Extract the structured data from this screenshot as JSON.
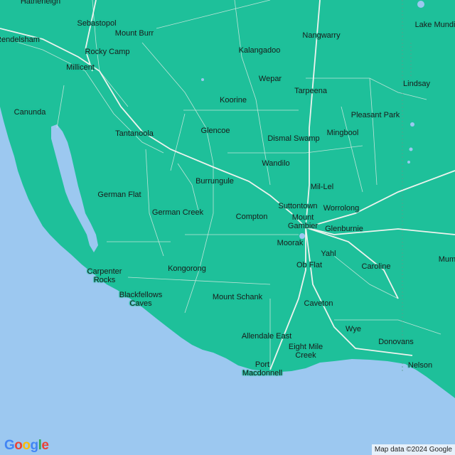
{
  "colors": {
    "land": "#1ec09a",
    "water": "#9cc8f0",
    "road": "#e8efe9",
    "highway": "#f2f2ec",
    "boundary": "#5c9c8a"
  },
  "labels": {
    "hatherleigh": "Hatherleigh",
    "sebastopol": "Sebastopol",
    "mount_burr": "Mount Burr",
    "rendelsham": "Rendelsham",
    "rocky_camp": "Rocky Camp",
    "millicent": "Millicent",
    "nangwarry": "Nangwarry",
    "kalangadoo": "Kalangadoo",
    "lake_mundi": "Lake Mundi",
    "wepar": "Wepar",
    "tarpeena": "Tarpeena",
    "lindsay": "Lindsay",
    "koorine": "Koorine",
    "canunda": "Canunda",
    "pleasant_park": "Pleasant Park",
    "tantanoola": "Tantanoola",
    "glencoe": "Glencoe",
    "mingbool": "Mingbool",
    "dismal_swamp": "Dismal Swamp",
    "wandilo": "Wandilo",
    "burrungule": "Burrungule",
    "mil_lel": "Mil-Lel",
    "german_flat": "German Flat",
    "suttontown": "Suttontown",
    "worrolong": "Worrolong",
    "german_creek": "German Creek",
    "compton": "Compton",
    "mount_gambier": "Mount\nGambier",
    "glenburnie": "Glenburnie",
    "moorak": "Moorak",
    "yahl": "Yahl",
    "mum": "Mum",
    "ob_flat": "Ob Flat",
    "caroline": "Caroline",
    "carpenter_rocks": "Carpenter\nRocks",
    "kongorong": "Kongorong",
    "blackfellows_caves": "Blackfellows\nCaves",
    "mount_schank": "Mount Schank",
    "caveton": "Caveton",
    "wye": "Wye",
    "allendale_east": "Allendale East",
    "donovans": "Donovans",
    "eight_mile_creek": "Eight Mile\nCreek",
    "nelson": "Nelson",
    "port_macdonnell": "Port\nMacdonnell"
  },
  "footer": {
    "logo": [
      "G",
      "o",
      "o",
      "g",
      "l",
      "e"
    ],
    "logo_colors": [
      "#4285f4",
      "#ea4335",
      "#fbbc05",
      "#4285f4",
      "#34a853",
      "#ea4335"
    ],
    "attribution": "Map data ©2024 Google"
  }
}
